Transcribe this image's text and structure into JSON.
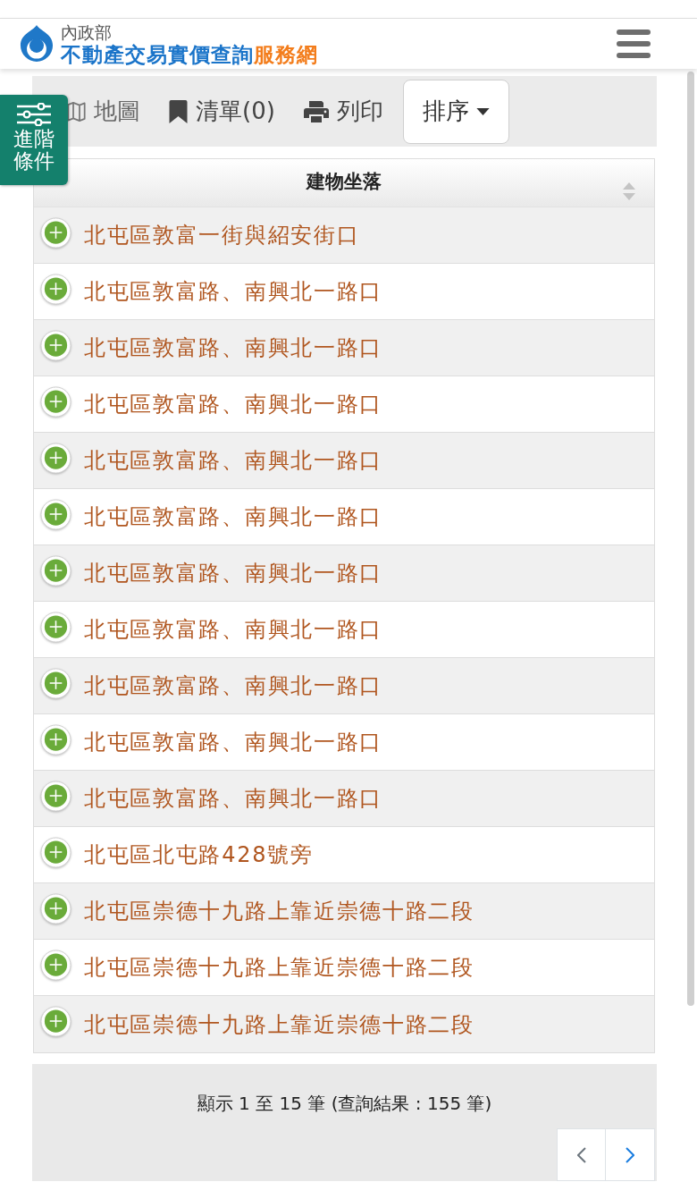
{
  "header": {
    "agency": "內政部",
    "title": "不動產交易實價查詢",
    "title_accent": "服務網"
  },
  "side_tab": {
    "label": "進階條件"
  },
  "toolbar": {
    "map": {
      "label": "地圖"
    },
    "list": {
      "label": "清單(0)"
    },
    "print": {
      "label": "列印"
    },
    "sort": {
      "label": "排序"
    }
  },
  "table": {
    "columns": [
      {
        "label": "建物坐落",
        "sortable": true
      }
    ],
    "rows": [
      {
        "address": "北屯區敦富一街與紹安街口"
      },
      {
        "address": "北屯區敦富路、南興北一路口"
      },
      {
        "address": "北屯區敦富路、南興北一路口"
      },
      {
        "address": "北屯區敦富路、南興北一路口"
      },
      {
        "address": "北屯區敦富路、南興北一路口"
      },
      {
        "address": "北屯區敦富路、南興北一路口"
      },
      {
        "address": "北屯區敦富路、南興北一路口"
      },
      {
        "address": "北屯區敦富路、南興北一路口"
      },
      {
        "address": "北屯區敦富路、南興北一路口"
      },
      {
        "address": "北屯區敦富路、南興北一路口"
      },
      {
        "address": "北屯區敦富路、南興北一路口"
      },
      {
        "address": "北屯區北屯路428號旁"
      },
      {
        "address": "北屯區崇德十九路上靠近崇德十路二段"
      },
      {
        "address": "北屯區崇德十九路上靠近崇德十路二段"
      },
      {
        "address": "北屯區崇德十九路上靠近崇德十路二段"
      }
    ]
  },
  "pagination": {
    "summary": "顯示 1 至 15 筆 (查詢結果 : 155 筆)",
    "prev": {
      "disabled": true
    },
    "next": {
      "disabled": false
    }
  }
}
